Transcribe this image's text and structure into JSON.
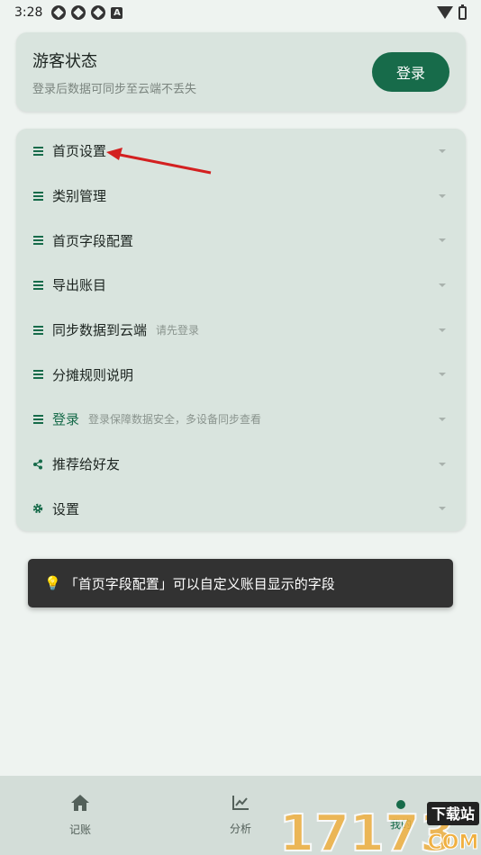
{
  "status_bar": {
    "time": "3:28",
    "app_icon_letter": "A"
  },
  "guest": {
    "title": "游客状态",
    "subtitle": "登录后数据可同步至云端不丢失",
    "login_label": "登录"
  },
  "menu": {
    "items": [
      {
        "label": "首页设置",
        "hint": "",
        "icon": "list-icon"
      },
      {
        "label": "类别管理",
        "hint": "",
        "icon": "list-icon"
      },
      {
        "label": "首页字段配置",
        "hint": "",
        "icon": "list-icon"
      },
      {
        "label": "导出账目",
        "hint": "",
        "icon": "list-icon"
      },
      {
        "label": "同步数据到云端",
        "hint": "请先登录",
        "icon": "list-icon"
      },
      {
        "label": "分摊规则说明",
        "hint": "",
        "icon": "list-icon"
      },
      {
        "label": "登录",
        "hint": "登录保障数据安全，多设备同步查看",
        "icon": "list-icon"
      },
      {
        "label": "推荐给好友",
        "hint": "",
        "icon": "share-icon"
      },
      {
        "label": "设置",
        "hint": "",
        "icon": "gear-icon"
      }
    ]
  },
  "toast": {
    "bulb": "💡",
    "text": "「首页字段配置」可以自定义账目显示的字段"
  },
  "bottom_nav": {
    "items": [
      {
        "label": "记账",
        "icon": "home-icon"
      },
      {
        "label": "分析",
        "icon": "chart-icon"
      },
      {
        "label": "我的",
        "icon": "profile-icon"
      }
    ]
  },
  "watermark": {
    "number": "17173",
    "tag": "下载站",
    "domain": "COM"
  },
  "colors": {
    "accent": "#176b4a",
    "card": "#d9e4de",
    "background": "#eef3f0",
    "toast": "#323232",
    "annotation_arrow": "#d32020"
  }
}
